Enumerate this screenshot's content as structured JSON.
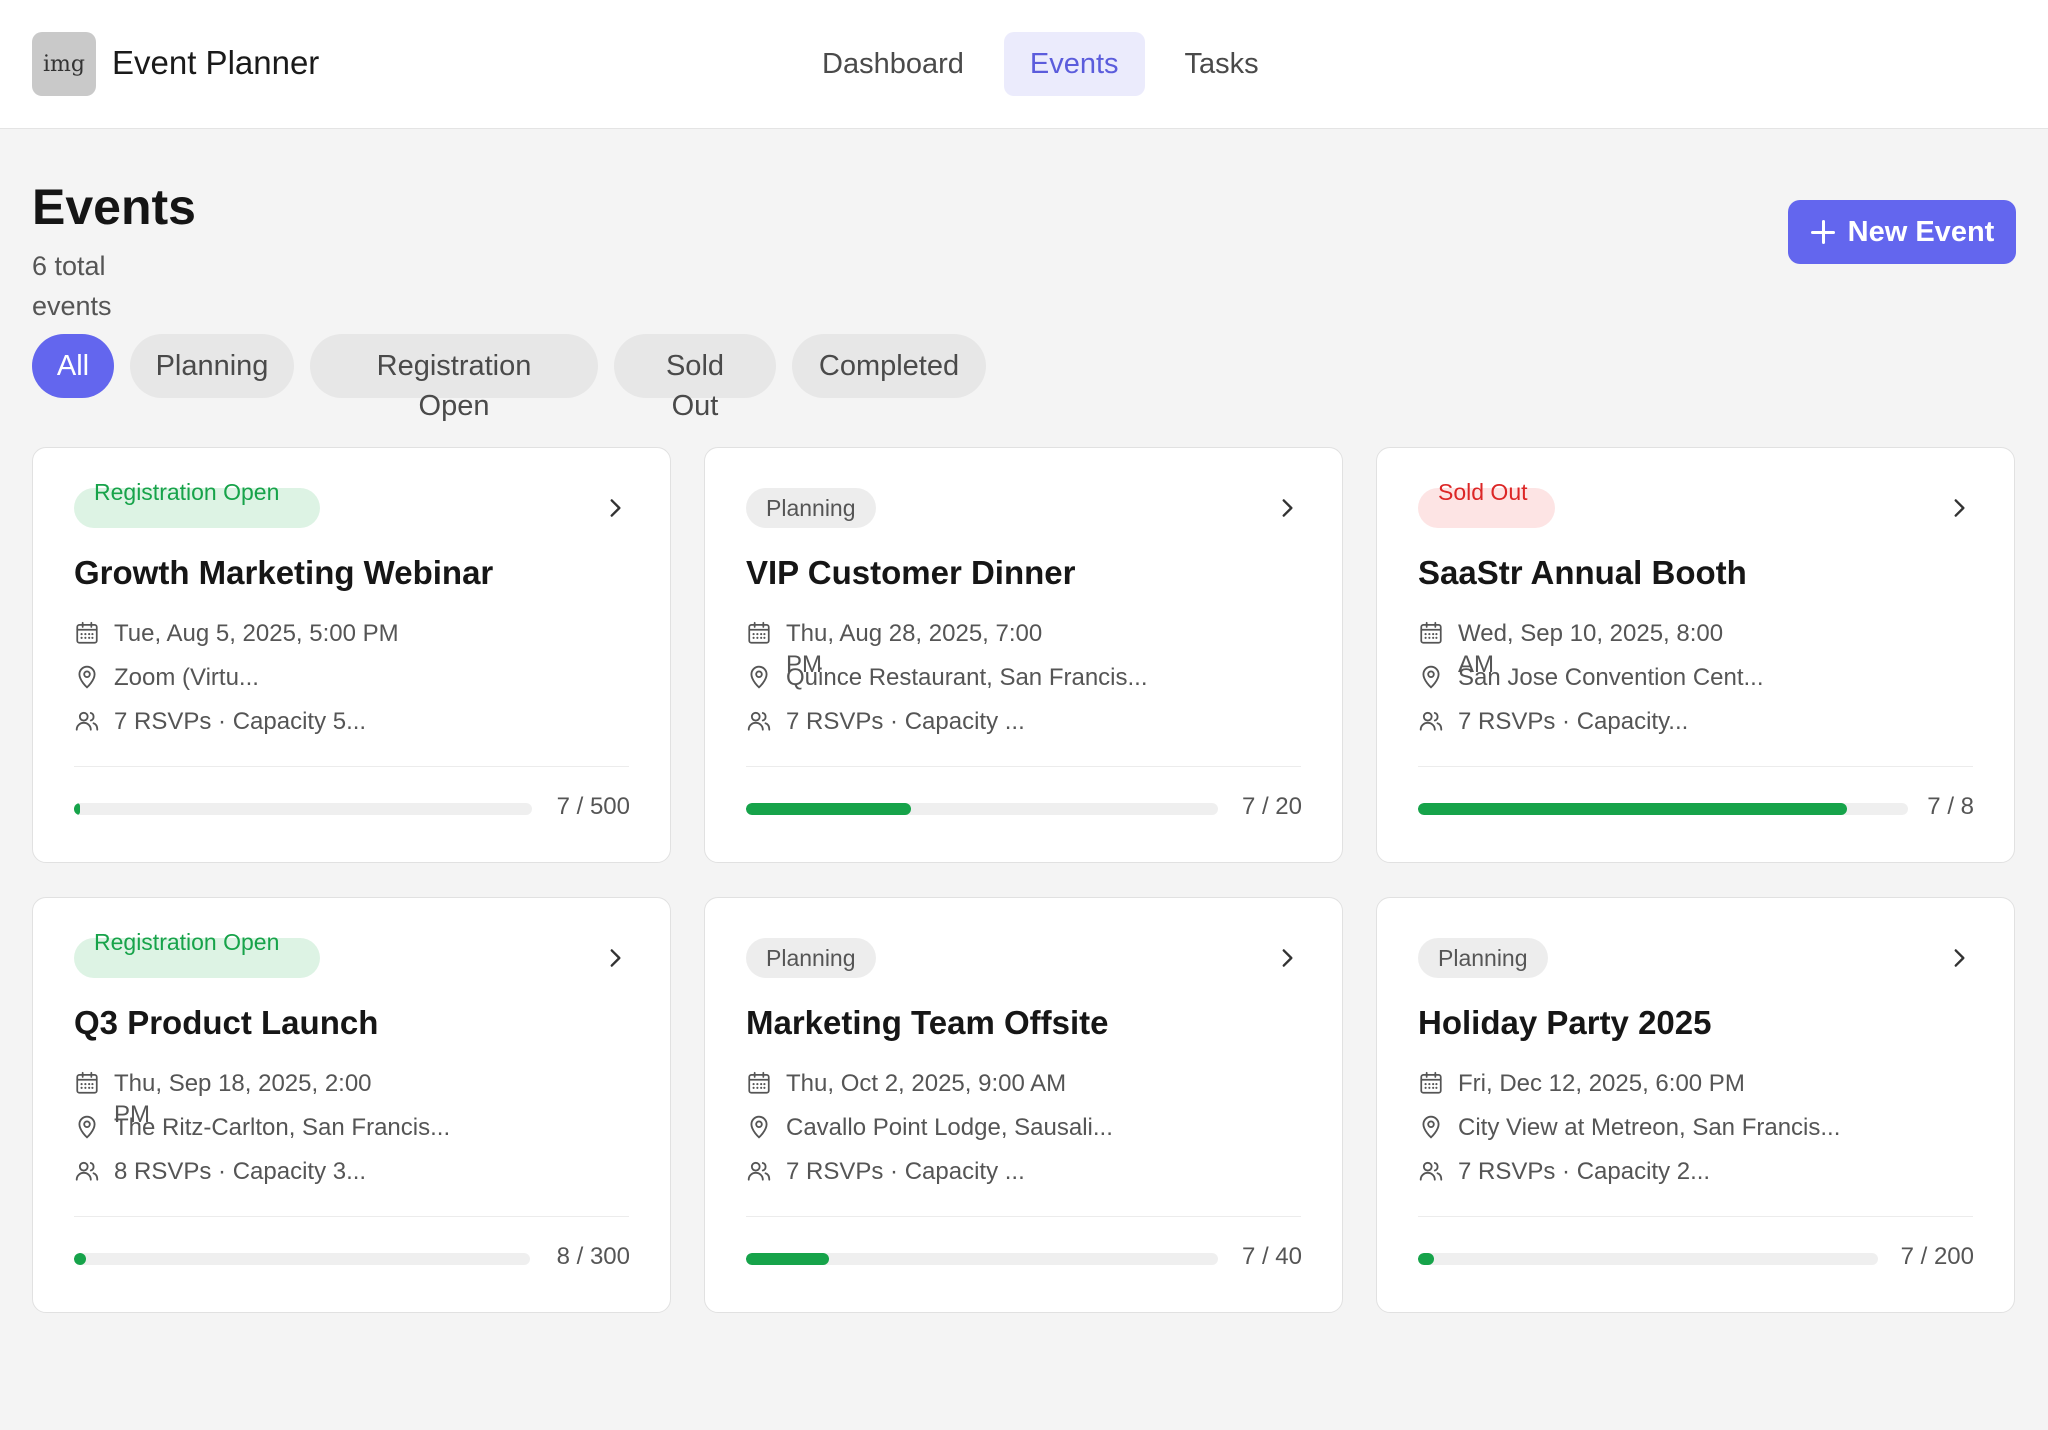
{
  "app": {
    "logo_text": "img",
    "title": "Event Planner"
  },
  "nav": [
    {
      "label": "Dashboard",
      "active": false
    },
    {
      "label": "Events",
      "active": true
    },
    {
      "label": "Tasks",
      "active": false
    }
  ],
  "page": {
    "title": "Events",
    "subtitle": "6 total events",
    "new_button": "New Event"
  },
  "filters": [
    {
      "label": "All",
      "active": true
    },
    {
      "label": "Planning",
      "active": false
    },
    {
      "label": "Registration Open",
      "active": false
    },
    {
      "label": "Sold Out",
      "active": false
    },
    {
      "label": "Completed",
      "active": false
    }
  ],
  "events": [
    {
      "status": "Registration Open",
      "status_color": "green",
      "title": "Growth Marketing Webinar",
      "date": "Tue, Aug 5, 2025, 5:00 PM",
      "location": "Zoom (Virtu...",
      "rsvps": "7 RSVPs · Capacity 5...",
      "count": "7 / 500",
      "fill": 0.014
    },
    {
      "status": "Planning",
      "status_color": "gray",
      "title": "VIP Customer Dinner",
      "date": "Thu, Aug 28, 2025, 7:00 PM",
      "location": "Quince Restaurant, San Francis...",
      "rsvps": "7 RSVPs · Capacity ...",
      "count": "7 / 20",
      "fill": 0.35
    },
    {
      "status": "Sold Out",
      "status_color": "red",
      "title": "SaaStr Annual Booth",
      "date": "Wed, Sep 10, 2025, 8:00 AM",
      "location": "San Jose Convention Cent...",
      "rsvps": "7 RSVPs · Capacity...",
      "count": "7 / 8",
      "fill": 0.875
    },
    {
      "status": "Registration Open",
      "status_color": "green",
      "title": "Q3 Product Launch",
      "date": "Thu, Sep 18, 2025, 2:00 PM",
      "location": "The Ritz-Carlton, San Francis...",
      "rsvps": "8 RSVPs · Capacity 3...",
      "count": "8 / 300",
      "fill": 0.027
    },
    {
      "status": "Planning",
      "status_color": "gray",
      "title": "Marketing Team Offsite",
      "date": "Thu, Oct 2, 2025, 9:00 AM",
      "location": "Cavallo Point Lodge, Sausali...",
      "rsvps": "7 RSVPs · Capacity ...",
      "count": "7 / 40",
      "fill": 0.175
    },
    {
      "status": "Planning",
      "status_color": "gray",
      "title": "Holiday Party 2025",
      "date": "Fri, Dec 12, 2025, 6:00 PM",
      "location": "City View at Metreon, San Francis...",
      "rsvps": "7 RSVPs · Capacity 2...",
      "count": "7 / 200",
      "fill": 0.035
    }
  ],
  "colors": {
    "accent": "#6366ee",
    "nav_active_bg": "#ebebfc",
    "progress": "#16a34a",
    "badge_green": "#17a34a",
    "badge_red": "#dc2626"
  }
}
